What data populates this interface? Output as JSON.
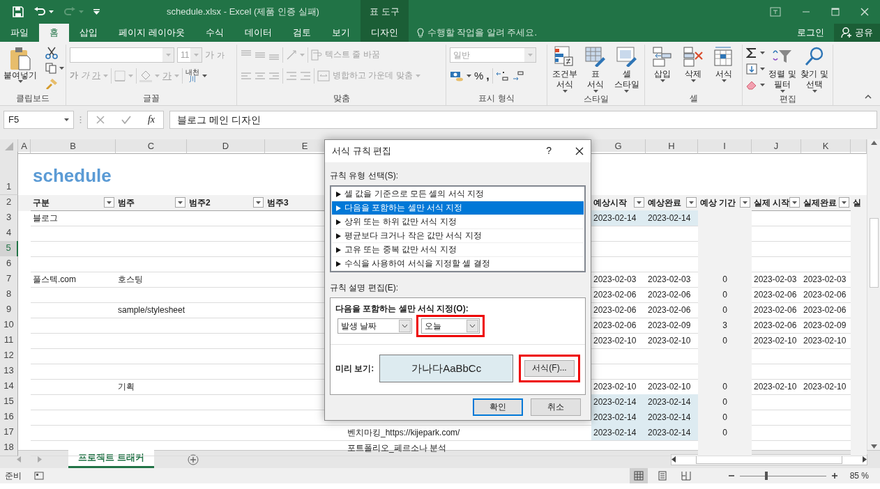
{
  "window": {
    "title": "schedule.xlsx - Excel (제품 인증 실패)",
    "context_group": "표 도구"
  },
  "quick_access": [
    {
      "kind": "save",
      "disabled": false
    },
    {
      "kind": "undo",
      "disabled": false
    },
    {
      "kind": "redo",
      "disabled": true
    },
    {
      "kind": "customize",
      "disabled": false
    }
  ],
  "ribbon_tabs": [
    {
      "label": "파일",
      "selected": false,
      "kind": "normal"
    },
    {
      "label": "홈",
      "selected": true,
      "kind": "normal"
    },
    {
      "label": "삽입",
      "selected": false,
      "kind": "normal"
    },
    {
      "label": "페이지 레이아웃",
      "selected": false,
      "kind": "normal"
    },
    {
      "label": "수식",
      "selected": false,
      "kind": "normal"
    },
    {
      "label": "데이터",
      "selected": false,
      "kind": "normal"
    },
    {
      "label": "검토",
      "selected": false,
      "kind": "normal"
    },
    {
      "label": "보기",
      "selected": false,
      "kind": "normal"
    },
    {
      "label": "디자인",
      "selected": false,
      "kind": "context"
    }
  ],
  "tell_me": "수행할 작업을 알려 주세요.",
  "sign_in": "로그인",
  "share": "공유",
  "clipboard": {
    "label": "클립보드",
    "paste": "붙여넣기"
  },
  "font": {
    "label": "글꼴",
    "disabled": true,
    "size": "11",
    "grow": "가",
    "shrink": "가",
    "bold": "가",
    "italic": "가",
    "underline": "가",
    "font_color": "가",
    "phonetic": "내천",
    "phonetic_sub": "川"
  },
  "alignment": {
    "label": "맞춤",
    "disabled": true,
    "wrap_text": "텍스트 줄 바꿈",
    "merge": "병합하고 가운데 맞춤"
  },
  "number": {
    "label": "표시 형식",
    "format": "일반",
    "format_disabled": true,
    "percent": "%",
    "comma": ","
  },
  "styles": {
    "label": "스타일",
    "buttons": [
      {
        "kind": "conditional",
        "lines": [
          "조건부",
          "서식"
        ]
      },
      {
        "kind": "table",
        "lines": [
          "표",
          "서식"
        ]
      },
      {
        "kind": "cell_style",
        "lines": [
          "셀",
          "스타일"
        ]
      }
    ]
  },
  "cells": {
    "label": "셀",
    "buttons": [
      {
        "kind": "insert",
        "lines": [
          "삽입"
        ]
      },
      {
        "kind": "delete",
        "lines": [
          "삭제"
        ]
      },
      {
        "kind": "format",
        "lines": [
          "서식"
        ]
      }
    ]
  },
  "editing": {
    "label": "편집",
    "buttons": [
      {
        "kind": "sort",
        "lines": [
          "정렬 및",
          "필터"
        ]
      },
      {
        "kind": "find",
        "lines": [
          "찾기 및",
          "선택"
        ]
      }
    ]
  },
  "formula_bar": {
    "name_box": "F5",
    "fx": "fx",
    "formula": "블로그 메인 디자인"
  },
  "columns": [
    {
      "letter": "A"
    },
    {
      "letter": "B"
    },
    {
      "letter": "C"
    },
    {
      "letter": "D"
    },
    {
      "letter": "E"
    },
    {},
    {
      "letter": "G"
    },
    {
      "letter": "H"
    },
    {
      "letter": "I"
    },
    {
      "letter": "J"
    },
    {
      "letter": "K"
    },
    {}
  ],
  "rows": [
    {
      "number": "1",
      "kind": "title",
      "selected": false,
      "cells": {
        "B": "schedule"
      }
    },
    {
      "number": "2",
      "kind": "header",
      "selected": false,
      "cells": {
        "B": {
          "text": "구분",
          "filter": true
        },
        "C": {
          "text": "범주",
          "filter": true
        },
        "D": {
          "text": "범주2",
          "filter": true
        },
        "E": {
          "text": "범주3",
          "filter": false
        },
        "G": {
          "text": "예상시작",
          "filter": true
        },
        "H": {
          "text": "예상완료",
          "filter": true
        },
        "I": {
          "text": "예상 기간",
          "filter": true
        },
        "J": {
          "text": "실제 시작",
          "filter": true
        },
        "K": {
          "text": "실제완료",
          "filter": true
        },
        "L": {
          "text": "실",
          "filter": false
        }
      }
    },
    {
      "number": "3",
      "kind": "data",
      "selected": false,
      "today": true,
      "cells": {
        "B": "블로그",
        "G": "2023-02-14",
        "H": "2023-02-14"
      }
    },
    {
      "number": "4",
      "kind": "data",
      "selected": false,
      "today": false,
      "cells": {}
    },
    {
      "number": "5",
      "kind": "data",
      "selected": true,
      "today": false,
      "cells": {}
    },
    {
      "number": "6",
      "kind": "data",
      "selected": false,
      "today": false,
      "cells": {}
    },
    {
      "number": "7",
      "kind": "data",
      "selected": false,
      "today": false,
      "cells": {
        "B": "풀스텍.com",
        "C": "호스팅",
        "G": "2023-02-03",
        "H": "2023-02-03",
        "I": "0",
        "J": "2023-02-03",
        "K": "2023-02-03"
      }
    },
    {
      "number": "8",
      "kind": "data",
      "selected": false,
      "today": false,
      "cells": {
        "G": "2023-02-06",
        "H": "2023-02-06",
        "I": "0",
        "J": "2023-02-06",
        "K": "2023-02-06"
      }
    },
    {
      "number": "9",
      "kind": "data",
      "selected": false,
      "today": false,
      "cells": {
        "C": "sample/stylesheet",
        "G": "2023-02-06",
        "H": "2023-02-06",
        "I": "0",
        "J": "2023-02-06",
        "K": "2023-02-06"
      }
    },
    {
      "number": "10",
      "kind": "data",
      "selected": false,
      "today": false,
      "cells": {
        "G": "2023-02-06",
        "H": "2023-02-09",
        "I": "3",
        "J": "2023-02-06",
        "K": "2023-02-09"
      }
    },
    {
      "number": "11",
      "kind": "data",
      "selected": false,
      "today": false,
      "cells": {
        "G": "2023-02-10",
        "H": "2023-02-10",
        "I": "0",
        "J": "2023-02-10",
        "K": "2023-02-10"
      }
    },
    {
      "number": "12",
      "kind": "data",
      "selected": false,
      "today": false,
      "cells": {}
    },
    {
      "number": "13",
      "kind": "data",
      "selected": false,
      "today": false,
      "cells": {}
    },
    {
      "number": "14",
      "kind": "data",
      "selected": false,
      "today": false,
      "cells": {
        "C": "기획",
        "G": "2023-02-10",
        "H": "2023-02-10",
        "I": "0",
        "J": "2023-02-10",
        "K": "2023-02-10"
      }
    },
    {
      "number": "15",
      "kind": "data",
      "selected": false,
      "today": true,
      "cells": {
        "G": "2023-02-14",
        "H": "2023-02-14",
        "I": "0"
      }
    },
    {
      "number": "16",
      "kind": "data",
      "selected": false,
      "today": true,
      "cells": {
        "G": "2023-02-14",
        "H": "2023-02-14",
        "I": "0"
      }
    },
    {
      "number": "17",
      "kind": "data",
      "selected": false,
      "today": true,
      "cells": {
        "F": "벤치마킹_https://kijepark.com/",
        "G": "2023-02-14",
        "H": "2023-02-14",
        "I": "0"
      }
    },
    {
      "number": "18",
      "kind": "data",
      "selected": false,
      "today": false,
      "cells": {
        "F": "포트폴리오_페르소나 분석"
      }
    }
  ],
  "dialog": {
    "title": "서식 규칙 편집",
    "help": "?",
    "rule_type_label": "규칙 유형 선택(S):",
    "rule_types": [
      {
        "label": "셀 값을 기준으로 모든 셀의 서식 지정",
        "selected": false
      },
      {
        "label": "다음을 포함하는 셀만 서식 지정",
        "selected": true
      },
      {
        "label": "상위 또는 하위 값만 서식 지정",
        "selected": false
      },
      {
        "label": "평균보다 크거나 작은 값만 서식 지정",
        "selected": false
      },
      {
        "label": "고유 또는 중복 값만 서식 지정",
        "selected": false
      },
      {
        "label": "수식을 사용하여 서식을 지정할 셀 결정",
        "selected": false
      }
    ],
    "description_label": "규칙 설명 편집(E):",
    "condition_label": "다음을 포함하는 셀만 서식 지정(O):",
    "selects": [
      {
        "value": "발생 날짜",
        "highlighted": false
      },
      {
        "value": "오늘",
        "highlighted": true
      }
    ],
    "preview_label": "미리 보기:",
    "preview_text": "가나다AaBbCc",
    "format_button": {
      "label": "서식(F)...",
      "highlighted": true
    },
    "buttons": [
      {
        "label": "확인",
        "default": true
      },
      {
        "label": "취소",
        "default": false
      }
    ]
  },
  "sheet_tabs": [
    {
      "label": "프로젝트 트래커",
      "selected": true
    }
  ],
  "status": {
    "text": "준비",
    "views": [
      {
        "kind": "normal",
        "selected": true
      },
      {
        "kind": "page_layout",
        "selected": false
      },
      {
        "kind": "page_break",
        "selected": false
      }
    ],
    "zoom": {
      "level": 0.3,
      "reading": "85 %"
    }
  }
}
